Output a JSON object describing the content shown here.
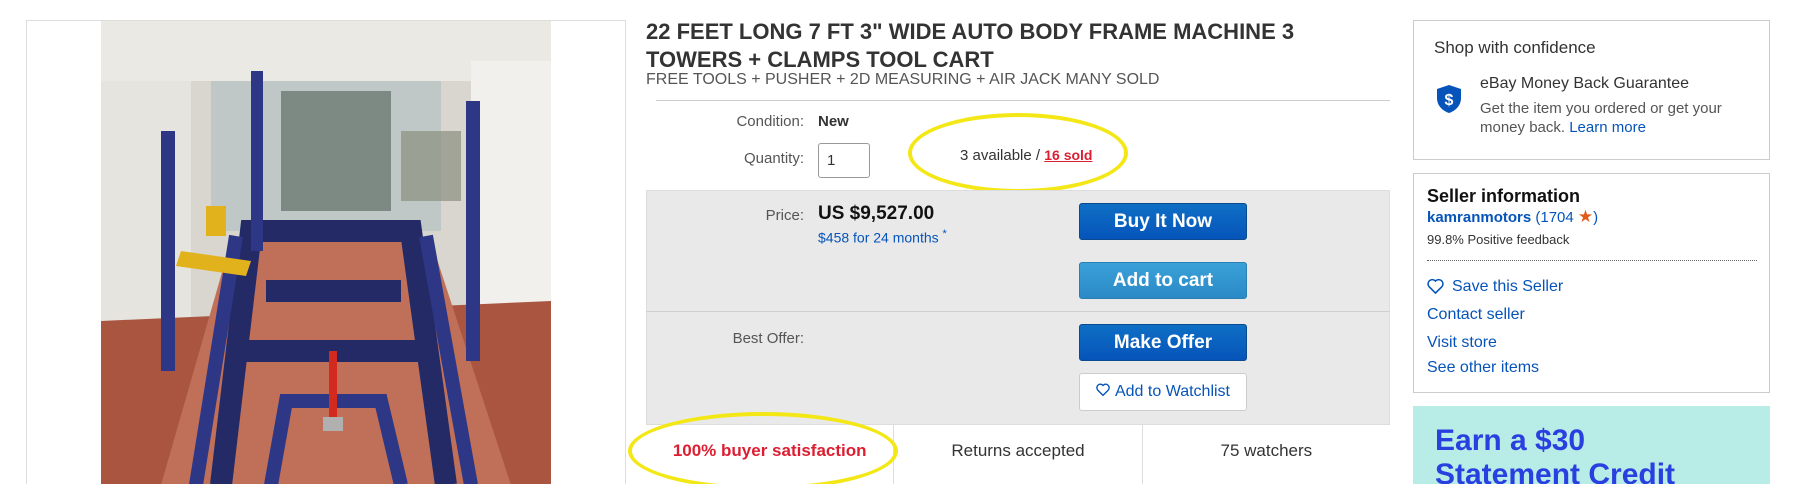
{
  "listing": {
    "title": "22 FEET LONG 7 FT 3\" WIDE AUTO BODY FRAME MACHINE 3 TOWERS + CLAMPS TOOL CART",
    "subtitle": "FREE TOOLS + PUSHER + 2D MEASURING + AIR JACK MANY SOLD"
  },
  "details": {
    "condition_label": "Condition:",
    "condition_value": "New",
    "quantity_label": "Quantity:",
    "quantity_value": "1",
    "available_text": "3 available / ",
    "sold_text": "16 sold"
  },
  "pricing": {
    "price_label": "Price:",
    "price_value": "US $9,527.00",
    "finance_text": "$458 for 24 months",
    "finance_marker": "*",
    "best_offer_label": "Best Offer:"
  },
  "buttons": {
    "buy_now": "Buy It Now",
    "add_to_cart": "Add to cart",
    "make_offer": "Make Offer",
    "add_to_watchlist": "Add to Watchlist"
  },
  "stats": {
    "satisfaction": "100% buyer satisfaction",
    "returns": "Returns accepted",
    "watchers": "75 watchers"
  },
  "shop_confidence": {
    "title": "Shop with confidence",
    "guarantee_title": "eBay Money Back Guarantee",
    "guarantee_text": "Get the item you ordered or get your money back.",
    "learn_more": "Learn more"
  },
  "seller": {
    "title": "Seller information",
    "name": "kamranmotors",
    "score_open": "(",
    "score": "1704",
    "score_close": ")",
    "feedback": "99.8% Positive feedback",
    "save_seller": "Save this Seller",
    "contact": "Contact seller",
    "visit_store": "Visit store",
    "other_items": "See other items"
  },
  "ad": {
    "line1": "Earn a $30",
    "line2": "Statement Credit"
  },
  "colors": {
    "accent_blue": "#0654ba",
    "highlight_yellow": "#f3e716",
    "alert_red": "#dd1e31",
    "ad_bg": "#b8ece6"
  }
}
